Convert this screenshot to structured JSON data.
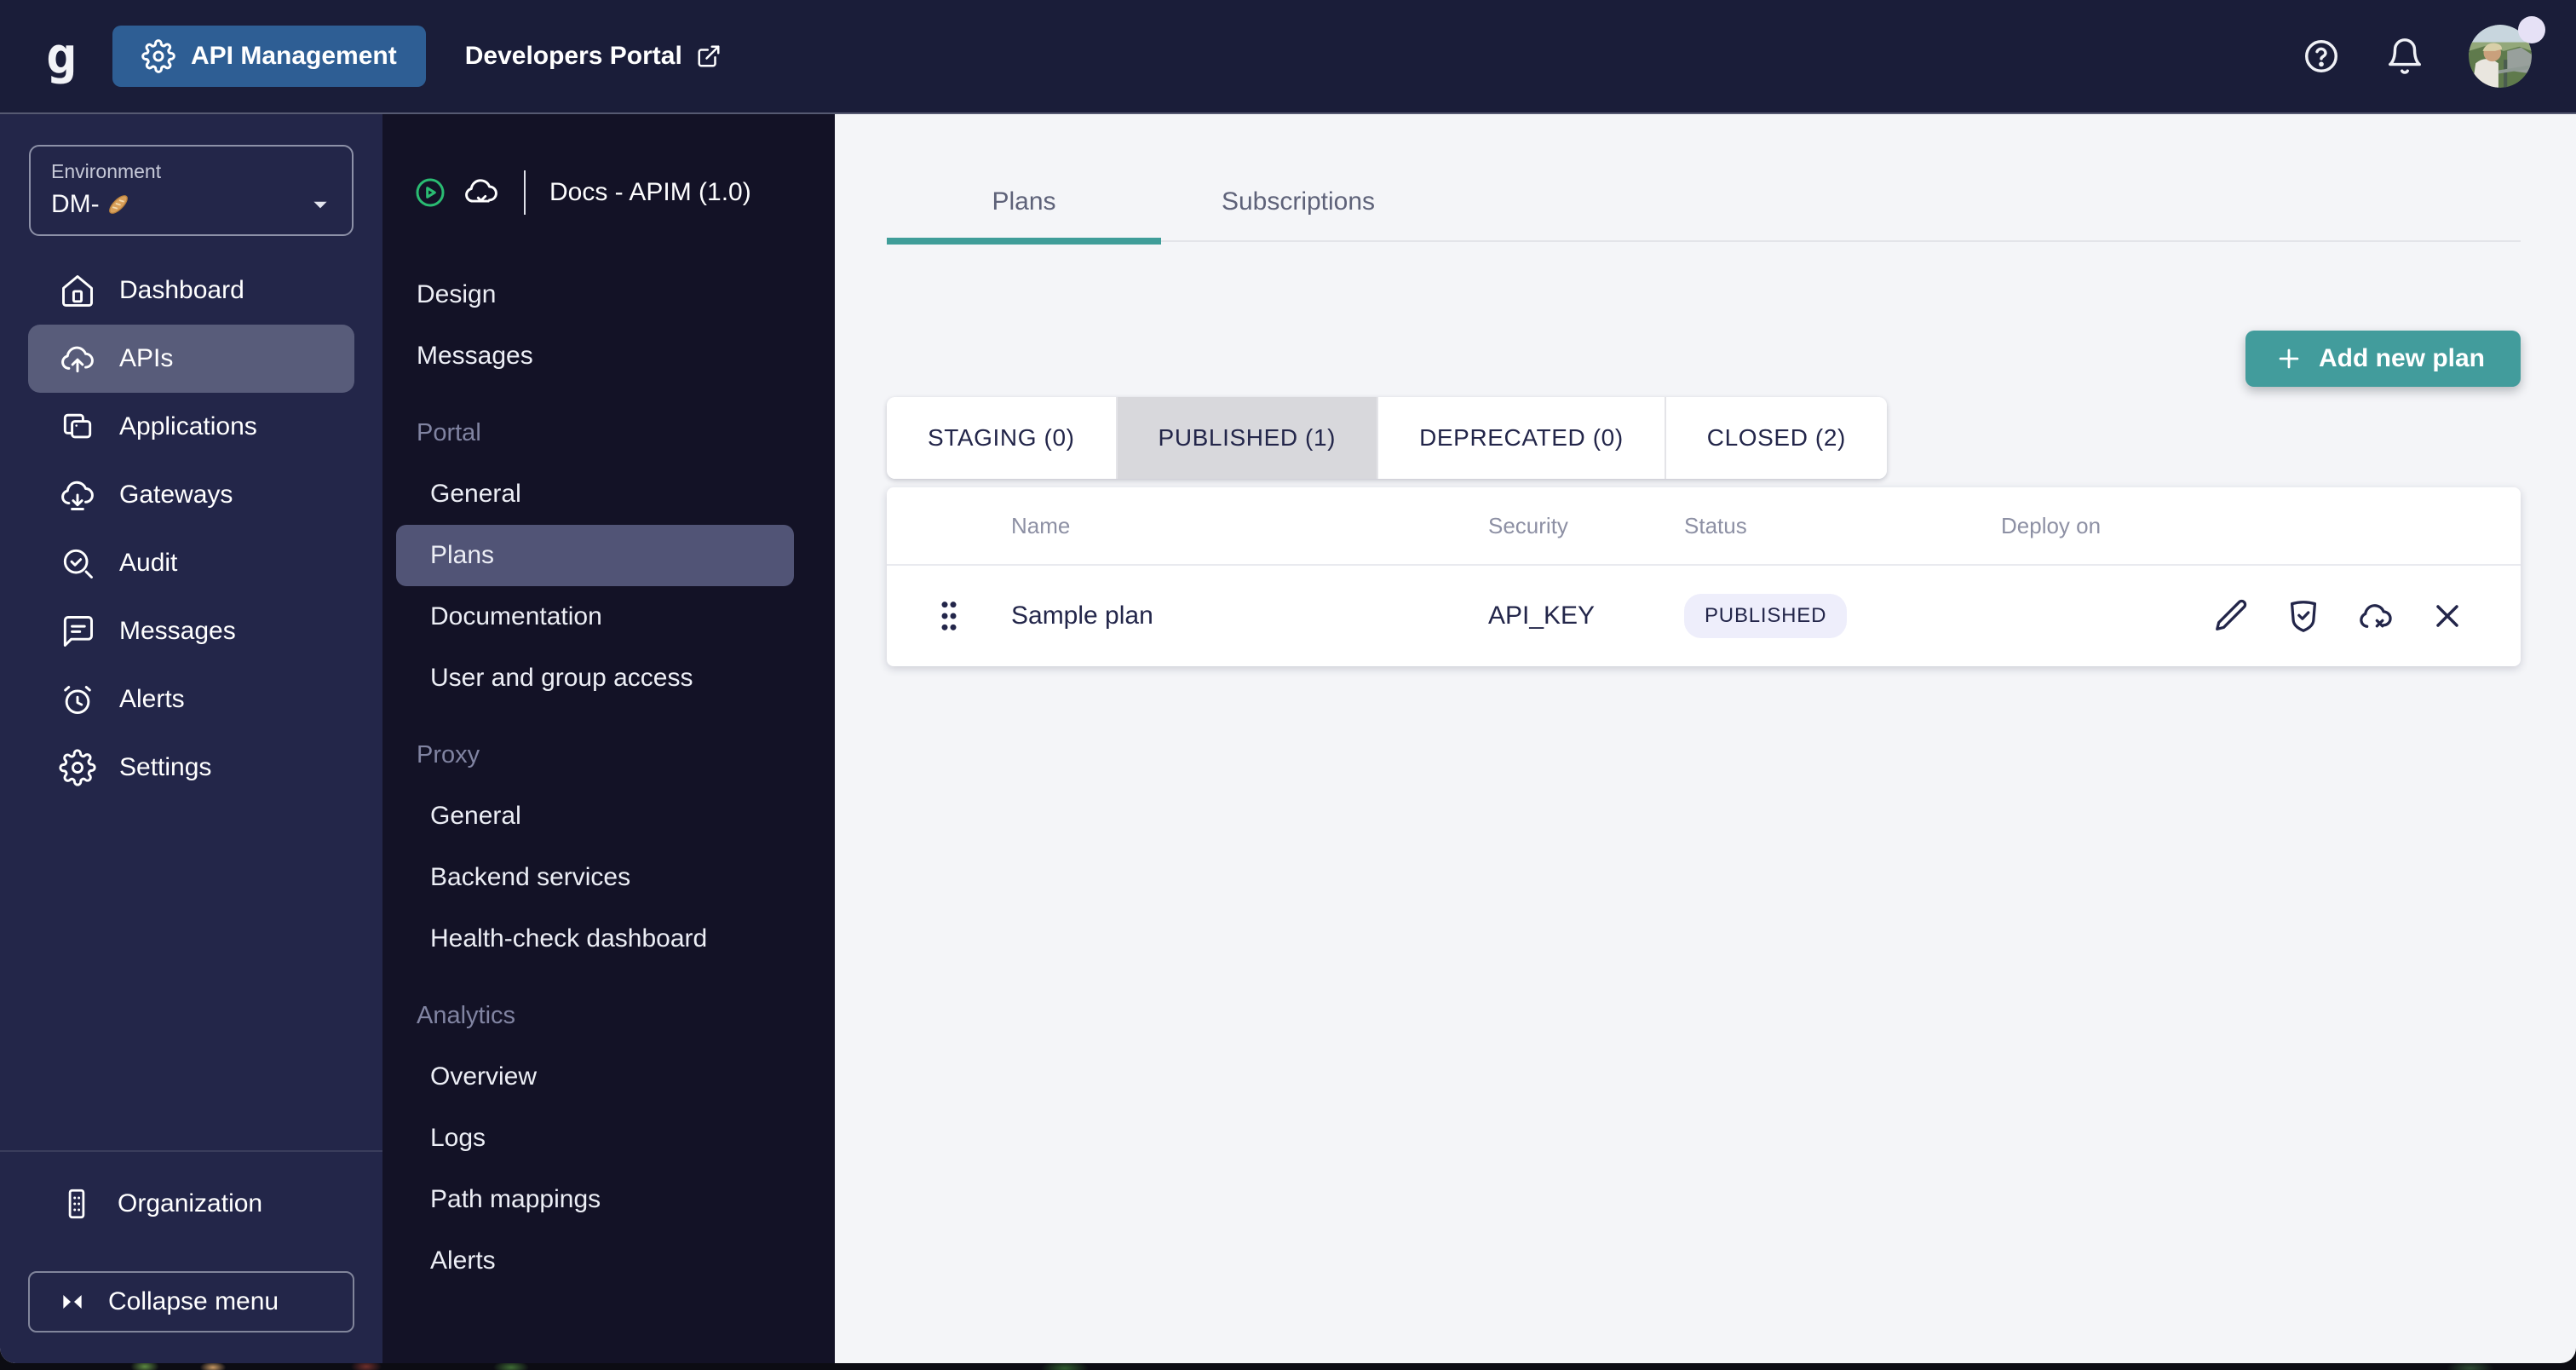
{
  "topbar": {
    "logo_letter": "g",
    "product_button_label": "API Management",
    "portal_link_label": "Developers Portal"
  },
  "left_sidebar": {
    "environment_label": "Environment",
    "environment_value": "DM-",
    "environment_value_emoji": "baguette",
    "items": [
      {
        "label": "Dashboard",
        "icon": "home-icon",
        "selected": false
      },
      {
        "label": "APIs",
        "icon": "cloud-upload-icon",
        "selected": true
      },
      {
        "label": "Applications",
        "icon": "applications-icon",
        "selected": false
      },
      {
        "label": "Gateways",
        "icon": "cloud-download-icon",
        "selected": false
      },
      {
        "label": "Audit",
        "icon": "audit-search-icon",
        "selected": false
      },
      {
        "label": "Messages",
        "icon": "chat-icon",
        "selected": false
      },
      {
        "label": "Alerts",
        "icon": "alarm-icon",
        "selected": false
      },
      {
        "label": "Settings",
        "icon": "gear-icon",
        "selected": false
      }
    ],
    "organization_label": "Organization",
    "collapse_label": "Collapse menu"
  },
  "api_sidebar": {
    "api_title": "Docs - APIM (1.0)",
    "items": [
      {
        "label": "Design",
        "type": "top"
      },
      {
        "label": "Messages",
        "type": "top"
      },
      {
        "label": "Portal",
        "type": "header"
      },
      {
        "label": "General",
        "type": "sub"
      },
      {
        "label": "Plans",
        "type": "sub",
        "selected": true
      },
      {
        "label": "Documentation",
        "type": "sub"
      },
      {
        "label": "User and group access",
        "type": "sub"
      },
      {
        "label": "Proxy",
        "type": "header"
      },
      {
        "label": "General",
        "type": "sub"
      },
      {
        "label": "Backend services",
        "type": "sub"
      },
      {
        "label": "Health-check dashboard",
        "type": "sub"
      },
      {
        "label": "Analytics",
        "type": "header"
      },
      {
        "label": "Overview",
        "type": "sub"
      },
      {
        "label": "Logs",
        "type": "sub"
      },
      {
        "label": "Path mappings",
        "type": "sub"
      },
      {
        "label": "Alerts",
        "type": "sub"
      }
    ]
  },
  "main": {
    "tabs": [
      {
        "label": "Plans",
        "active": true
      },
      {
        "label": "Subscriptions",
        "active": false
      }
    ],
    "add_plan_button": "Add new plan",
    "status_filters": [
      {
        "label": "STAGING (0)",
        "selected": false
      },
      {
        "label": "PUBLISHED (1)",
        "selected": true
      },
      {
        "label": "DEPRECATED (0)",
        "selected": false
      },
      {
        "label": "CLOSED (2)",
        "selected": false
      }
    ],
    "plans_table": {
      "columns": [
        "Name",
        "Security",
        "Status",
        "Deploy on"
      ],
      "rows": [
        {
          "name": "Sample plan",
          "security": "API_KEY",
          "status": "PUBLISHED"
        }
      ]
    }
  },
  "icons": [
    "gravitee-logo",
    "gear-icon",
    "external-link-icon",
    "help-icon",
    "bell-icon",
    "avatar",
    "status-dot",
    "chevron-down-icon",
    "baguette-emoji",
    "home-icon",
    "cloud-upload-icon",
    "applications-icon",
    "cloud-download-icon",
    "audit-search-icon",
    "chat-icon",
    "alarm-icon",
    "organization-icon",
    "collapse-icon",
    "play-circle-icon",
    "cloud-check-icon",
    "plus-icon",
    "drag-handle-icon",
    "edit-pencil-icon",
    "shield-check-icon",
    "cloud-x-icon",
    "close-x-icon"
  ],
  "colors": {
    "accent_teal": "#3f9d99",
    "button_teal": "#429c9c",
    "topbar_bg": "#1a1d39",
    "left_sidebar_bg": "#232649",
    "api_sidebar_bg": "#131226",
    "selected_item_bg": "#585c7a",
    "product_button_bg": "#2e5e94",
    "main_bg": "#f4f5f8",
    "badge_bg": "#eeeefb",
    "selected_filter_bg": "#d8d8dc",
    "play_icon_green": "#2abb72",
    "text_navy": "#23264a"
  }
}
